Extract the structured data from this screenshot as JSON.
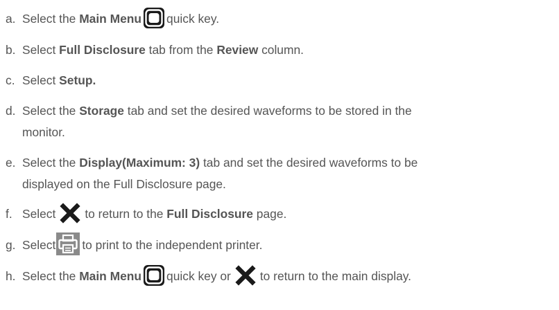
{
  "steps": [
    {
      "marker": "a.",
      "parts": [
        "Select the ",
        "Main Menu",
        "quick key."
      ]
    },
    {
      "marker": "b.",
      "parts": [
        "Select ",
        "Full Disclosure",
        " tab from the ",
        "Review",
        " column."
      ]
    },
    {
      "marker": "c.",
      "parts": [
        "Select ",
        "Setup."
      ]
    },
    {
      "marker": "d.",
      "parts": [
        "Select the ",
        "Storage",
        " tab and set the desired waveforms to be stored in the",
        "monitor."
      ]
    },
    {
      "marker": "e.",
      "parts": [
        "Select the ",
        "Display(Maximum: 3)",
        " tab and set the desired waveforms to be",
        "displayed on the Full Disclosure page."
      ]
    },
    {
      "marker": "f.",
      "parts": [
        "Select",
        "to return to the ",
        "Full Disclosure",
        " page."
      ]
    },
    {
      "marker": "g.",
      "parts": [
        "Select",
        "to print to the independent printer."
      ]
    },
    {
      "marker": "h.",
      "parts": [
        "Select the ",
        "Main Menu",
        "quick key or",
        "to return to the main display."
      ]
    }
  ],
  "icons": {
    "main_menu": "main-menu-icon",
    "close": "close-icon",
    "print": "print-icon"
  },
  "colors": {
    "text": "#555555",
    "icon_dark": "#1a1a1a",
    "icon_gray": "#8a8a8a"
  }
}
